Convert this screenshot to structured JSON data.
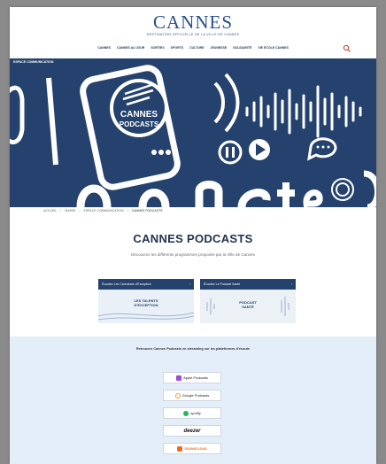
{
  "header": {
    "logo": "CANNES",
    "tagline": "DESTINATION  OFFICIELLE DE LA VILLE DE CANNES",
    "nav": [
      "CANNES",
      "CANNES AU JOUR",
      "SORTIES",
      "SPORTS",
      "CULTURE",
      "JEUNESSE",
      "SOLIDARITÉ",
      "VIE ÉCOLE CANNES"
    ]
  },
  "hero": {
    "label": "ESPACE COMMUNICATION",
    "badge_line1": "CANNES",
    "badge_line2": "PODCASTS"
  },
  "breadcrumb": [
    "ACCUEIL",
    "›",
    "MAIRIE",
    "›",
    "ESPACE COMMUNICATION",
    "›",
    "CANNES PODCASTS"
  ],
  "page": {
    "title": "CANNES PODCASTS",
    "subtitle": "Découvrez les différents programmes proposés par la Ville de Cannes"
  },
  "cards": [
    {
      "label": "Écoutez Les Cannoises d'Exception",
      "arrow": "›",
      "img_line1": "LES TALENTS",
      "img_line2": "D'EXCEPTION"
    },
    {
      "label": "Écoutez Le Podcast Santé",
      "arrow": "›",
      "img_line1": "PODCAST",
      "img_line2": "SANTÉ"
    }
  ],
  "platforms": {
    "heading": "Retrouvez Cannes Podcasts en streaming sur les plateformes d'écoute",
    "items": [
      {
        "name": "Apple Podcasts",
        "icon": "apple-podcasts-icon"
      },
      {
        "name": "Google Podcasts",
        "icon": "google-podcasts-icon"
      },
      {
        "name": "spotify",
        "icon": "spotify-icon"
      },
      {
        "name": "deezer",
        "icon": "deezer-icon"
      },
      {
        "name": "SOUNDCLOUD",
        "icon": "soundcloud-icon"
      }
    ]
  },
  "colors": {
    "brand_navy": "#24426d",
    "logo_blue": "#2a4e8f",
    "platform_bg": "#e4eef8"
  }
}
